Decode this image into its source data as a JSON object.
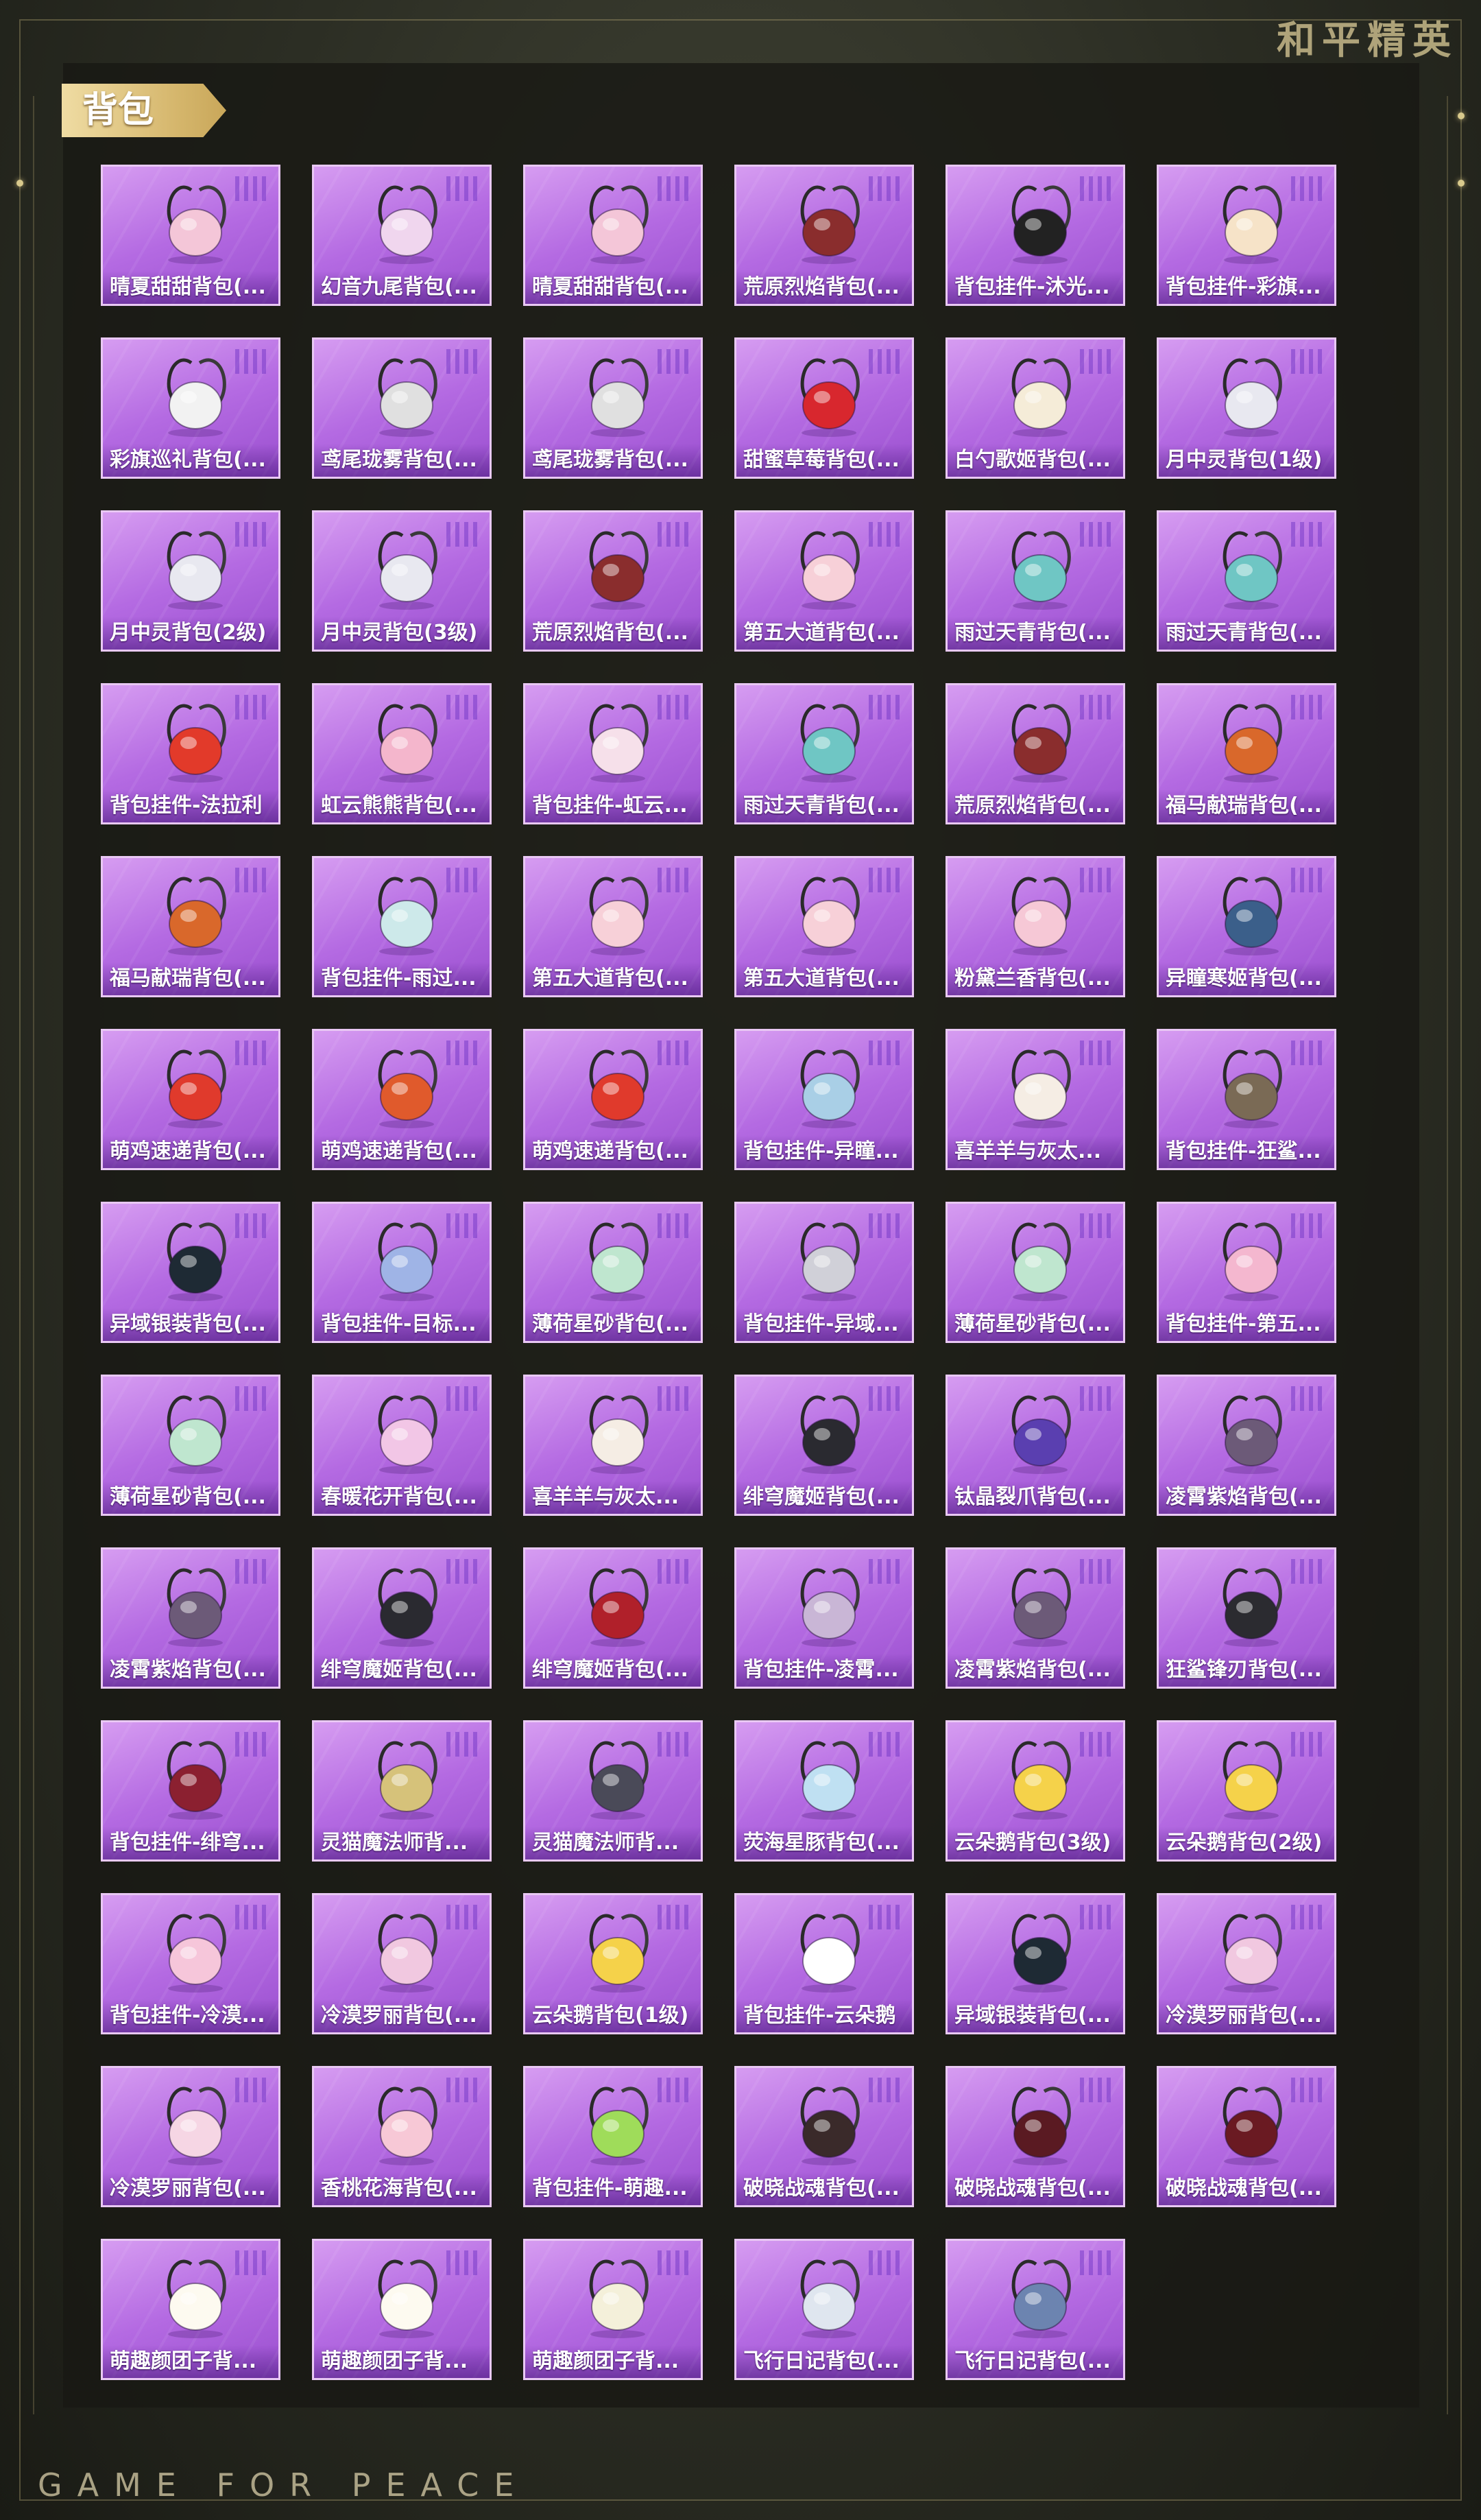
{
  "brand": {
    "corner_logo": "和平精英",
    "footer": "GAME FOR PEACE"
  },
  "section": {
    "title": "背包"
  },
  "colors": {
    "tile_purple": "#b46ae2",
    "tile_border": "#e9c8f4",
    "tab_gold": "#d5b66c"
  },
  "items": [
    {
      "name": "晴夏甜甜背包(...",
      "icon": "bunny-ear-backpack-icon",
      "color": "#f4c6d8"
    },
    {
      "name": "幻音九尾背包(...",
      "icon": "fox-backpack-icon",
      "color": "#f0d6ee"
    },
    {
      "name": "晴夏甜甜背包(...",
      "icon": "bunny-ear-backpack-icon",
      "color": "#f4c6d8"
    },
    {
      "name": "荒原烈焰背包(...",
      "icon": "wasteland-flame-backpack-icon",
      "color": "#8a2d2d"
    },
    {
      "name": "背包挂件-沐光...",
      "icon": "cat-charm-icon",
      "color": "#222222"
    },
    {
      "name": "背包挂件-彩旗...",
      "icon": "ice-cream-charm-icon",
      "color": "#f6e3c8"
    },
    {
      "name": "彩旗巡礼背包(...",
      "icon": "bunny-ear-backpack-icon",
      "color": "#f2f2f2"
    },
    {
      "name": "鸢尾珑雾背包(...",
      "icon": "small-bag-icon",
      "color": "#e0e0e0"
    },
    {
      "name": "鸢尾珑雾背包(...",
      "icon": "small-bag-icon",
      "color": "#e0e0e0"
    },
    {
      "name": "甜蜜草莓背包(...",
      "icon": "strawberry-backpack-icon",
      "color": "#d8272e"
    },
    {
      "name": "白勺歌姬背包(...",
      "icon": "bunny-plush-backpack-icon",
      "color": "#f5ecd8"
    },
    {
      "name": "月中灵背包(1级)",
      "icon": "moon-ring-icon",
      "color": "#e8e8f0"
    },
    {
      "name": "月中灵背包(2级)",
      "icon": "moon-ring-icon",
      "color": "#e8e8f0"
    },
    {
      "name": "月中灵背包(3级)",
      "icon": "moon-ring-icon",
      "color": "#e8e8f0"
    },
    {
      "name": "荒原烈焰背包(...",
      "icon": "wasteland-flame-backpack-icon",
      "color": "#8a2d2d"
    },
    {
      "name": "第五大道背包(...",
      "icon": "quilted-bag-icon",
      "color": "#f7d0d8"
    },
    {
      "name": "雨过天青背包(...",
      "icon": "celadon-backpack-icon",
      "color": "#6fc6c4"
    },
    {
      "name": "雨过天青背包(...",
      "icon": "celadon-backpack-icon",
      "color": "#6fc6c4"
    },
    {
      "name": "背包挂件-法拉利",
      "icon": "ferrari-keychain-icon",
      "color": "#e23a2a"
    },
    {
      "name": "虹云熊熊背包(...",
      "icon": "bear-cloud-backpack-icon",
      "color": "#f4b6cc"
    },
    {
      "name": "背包挂件-虹云...",
      "icon": "bear-charm-icon",
      "color": "#f6e0ea"
    },
    {
      "name": "雨过天青背包(...",
      "icon": "celadon-backpack-icon",
      "color": "#6fc6c4"
    },
    {
      "name": "荒原烈焰背包(...",
      "icon": "wasteland-flame-backpack-icon",
      "color": "#8a2d2d"
    },
    {
      "name": "福马献瑞背包(...",
      "icon": "horse-backpack-icon",
      "color": "#d9682b"
    },
    {
      "name": "福马献瑞背包(...",
      "icon": "horse-backpack-icon",
      "color": "#d9682b"
    },
    {
      "name": "背包挂件-雨过...",
      "icon": "sword-charm-icon",
      "color": "#cde9ea"
    },
    {
      "name": "第五大道背包(...",
      "icon": "quilted-bag-icon",
      "color": "#f7d0d8"
    },
    {
      "name": "第五大道背包(...",
      "icon": "quilted-bag-icon",
      "color": "#f7d0d8"
    },
    {
      "name": "粉黛兰香背包(...",
      "icon": "pink-orb-backpack-icon",
      "color": "#f6c8d6"
    },
    {
      "name": "异瞳寒姬背包(...",
      "icon": "blue-backpack-icon",
      "color": "#3b5f8a"
    },
    {
      "name": "萌鸡速递背包(...",
      "icon": "chick-backpack-icon",
      "color": "#e03a2c"
    },
    {
      "name": "萌鸡速递背包(...",
      "icon": "chick-backpack-icon",
      "color": "#e05a2c"
    },
    {
      "name": "萌鸡速递背包(...",
      "icon": "chick-backpack-icon",
      "color": "#e03a2c"
    },
    {
      "name": "背包挂件-异瞳...",
      "icon": "bell-charm-icon",
      "color": "#a9cfe6"
    },
    {
      "name": "喜羊羊与灰太...",
      "icon": "sheep-charm-icon",
      "color": "#f5ede4"
    },
    {
      "name": "背包挂件-狂鲨...",
      "icon": "shark-fin-charm-icon",
      "color": "#7a6a55"
    },
    {
      "name": "异域银装背包(...",
      "icon": "tactical-backpack-icon",
      "color": "#1e2a34"
    },
    {
      "name": "背包挂件-目标...",
      "icon": "target-ring-charm-icon",
      "color": "#9fb4e6"
    },
    {
      "name": "薄荷星砂背包(...",
      "icon": "mint-bag-icon",
      "color": "#bfe6cf"
    },
    {
      "name": "背包挂件-异域...",
      "icon": "wing-charm-icon",
      "color": "#d0d0d8"
    },
    {
      "name": "薄荷星砂背包(...",
      "icon": "mint-bag-icon",
      "color": "#bfe6cf"
    },
    {
      "name": "背包挂件-第五...",
      "icon": "heart-charm-icon",
      "color": "#f4b7cf"
    },
    {
      "name": "薄荷星砂背包(...",
      "icon": "mint-bag-icon",
      "color": "#bfe6cf"
    },
    {
      "name": "春暖花开背包(...",
      "icon": "flower-backpack-icon",
      "color": "#f2c6e6"
    },
    {
      "name": "喜羊羊与灰太...",
      "icon": "sheep-backpack-icon",
      "color": "#f5ede4"
    },
    {
      "name": "绯穹魔姬背包(...",
      "icon": "demon-backpack-icon",
      "color": "#2a2a30"
    },
    {
      "name": "钛晶裂爪背包(...",
      "icon": "crystal-claw-backpack-icon",
      "color": "#5a3fb0"
    },
    {
      "name": "凌霄紫焰背包(...",
      "icon": "purple-flame-backpack-icon",
      "color": "#6c5a78"
    },
    {
      "name": "凌霄紫焰背包(...",
      "icon": "purple-flame-backpack-icon",
      "color": "#6c5a78"
    },
    {
      "name": "绯穹魔姬背包(...",
      "icon": "demon-backpack-icon",
      "color": "#2a2a30"
    },
    {
      "name": "绯穹魔姬背包(...",
      "icon": "bat-backpack-icon",
      "color": "#b0202a"
    },
    {
      "name": "背包挂件-凌霄...",
      "icon": "feather-charm-icon",
      "color": "#c9b6d6"
    },
    {
      "name": "凌霄紫焰背包(...",
      "icon": "purple-flame-backpack-icon",
      "color": "#6c5a78"
    },
    {
      "name": "狂鲨锋刃背包(...",
      "icon": "shark-backpack-icon",
      "color": "#2b2b30"
    },
    {
      "name": "背包挂件-绯穹...",
      "icon": "crescent-charm-icon",
      "color": "#8b2030"
    },
    {
      "name": "灵猫魔法师背...",
      "icon": "cat-magician-charm-icon",
      "color": "#d6c27a"
    },
    {
      "name": "灵猫魔法师背...",
      "icon": "cat-magician-backpack-icon",
      "color": "#4a4a58"
    },
    {
      "name": "荧海星豚背包(...",
      "icon": "dolphin-backpack-icon",
      "color": "#bfe0f2"
    },
    {
      "name": "云朵鹅背包(3级)",
      "icon": "cloud-goose-backpack-icon",
      "color": "#f5d24a"
    },
    {
      "name": "云朵鹅背包(2级)",
      "icon": "cloud-goose-backpack-icon",
      "color": "#f5d24a"
    },
    {
      "name": "背包挂件-冷漠...",
      "icon": "blossom-charm-icon",
      "color": "#f6c6da"
    },
    {
      "name": "冷漠罗丽背包(...",
      "icon": "lolita-backpack-icon",
      "color": "#f1c8e0"
    },
    {
      "name": "云朵鹅背包(1级)",
      "icon": "cloud-goose-backpack-icon",
      "color": "#f5d24a"
    },
    {
      "name": "背包挂件-云朵鹅",
      "icon": "goose-badge-charm-icon",
      "color": "#ffffff"
    },
    {
      "name": "异域银装背包(...",
      "icon": "tactical-backpack-icon",
      "color": "#1e2a34"
    },
    {
      "name": "冷漠罗丽背包(...",
      "icon": "lolita-backpack-icon",
      "color": "#f1c8e0"
    },
    {
      "name": "冷漠罗丽背包(...",
      "icon": "lolita-bow-backpack-icon",
      "color": "#f6d6e4"
    },
    {
      "name": "香桃花海背包(...",
      "icon": "peach-blossom-backpack-icon",
      "color": "#f7c8d6"
    },
    {
      "name": "背包挂件-萌趣...",
      "icon": "green-sprout-charm-icon",
      "color": "#9fdc5a"
    },
    {
      "name": "破晓战魂背包(...",
      "icon": "war-soul-backpack-icon",
      "color": "#3a2a2a"
    },
    {
      "name": "破晓战魂背包(...",
      "icon": "war-soul-backpack-icon",
      "color": "#5a1a22"
    },
    {
      "name": "破晓战魂背包(...",
      "icon": "war-soul-backpack-icon",
      "color": "#6a1a22"
    },
    {
      "name": "萌趣颜团子背...",
      "icon": "radish-backpack-icon",
      "color": "#fdfaf0"
    },
    {
      "name": "萌趣颜团子背...",
      "icon": "radish-backpack-icon",
      "color": "#fdfaf0"
    },
    {
      "name": "萌趣颜团子背...",
      "icon": "radish-backpack-icon",
      "color": "#f4f0da"
    },
    {
      "name": "飞行日记背包(...",
      "icon": "flight-diary-backpack-icon",
      "color": "#dfe6ef"
    },
    {
      "name": "飞行日记背包(...",
      "icon": "flight-diary-backpack-icon",
      "color": "#6c84b0"
    }
  ]
}
